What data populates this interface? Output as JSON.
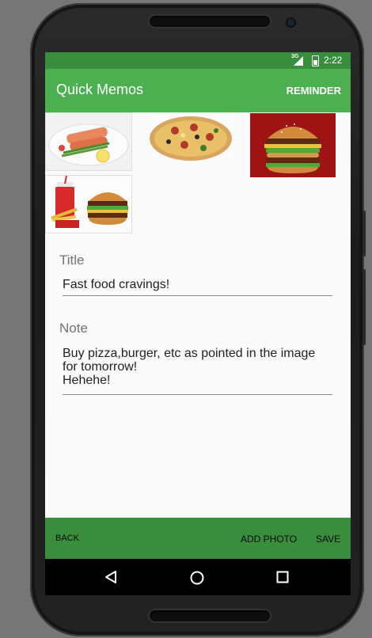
{
  "status_bar": {
    "network": "3G",
    "time": "2:22"
  },
  "app_bar": {
    "title": "Quick Memos",
    "reminder_label": "REMINDER"
  },
  "photos": [
    {
      "name": "salmon-plate-photo",
      "alt": "salmon plate"
    },
    {
      "name": "pizza-photo",
      "alt": "pizza"
    },
    {
      "name": "burger-photo",
      "alt": "burger"
    },
    {
      "name": "fast-food-combo-photo",
      "alt": "fast food combo"
    }
  ],
  "form": {
    "title_label": "Title",
    "title_value": "Fast food cravings!",
    "note_label": "Note",
    "note_value": "Buy pizza,burger, etc as pointed in the image\nfor tomorrow!\nHehehe!"
  },
  "bottom_bar": {
    "back_label": "BACK",
    "add_photo_label": "ADD PHOTO",
    "save_label": "SAVE"
  },
  "nav_bar": {
    "back_icon": "triangle-back-icon",
    "home_icon": "circle-home-icon",
    "recents_icon": "square-recents-icon"
  },
  "colors": {
    "primary": "#4caf50",
    "primary_dark": "#388e3c",
    "background": "#fafafa"
  }
}
